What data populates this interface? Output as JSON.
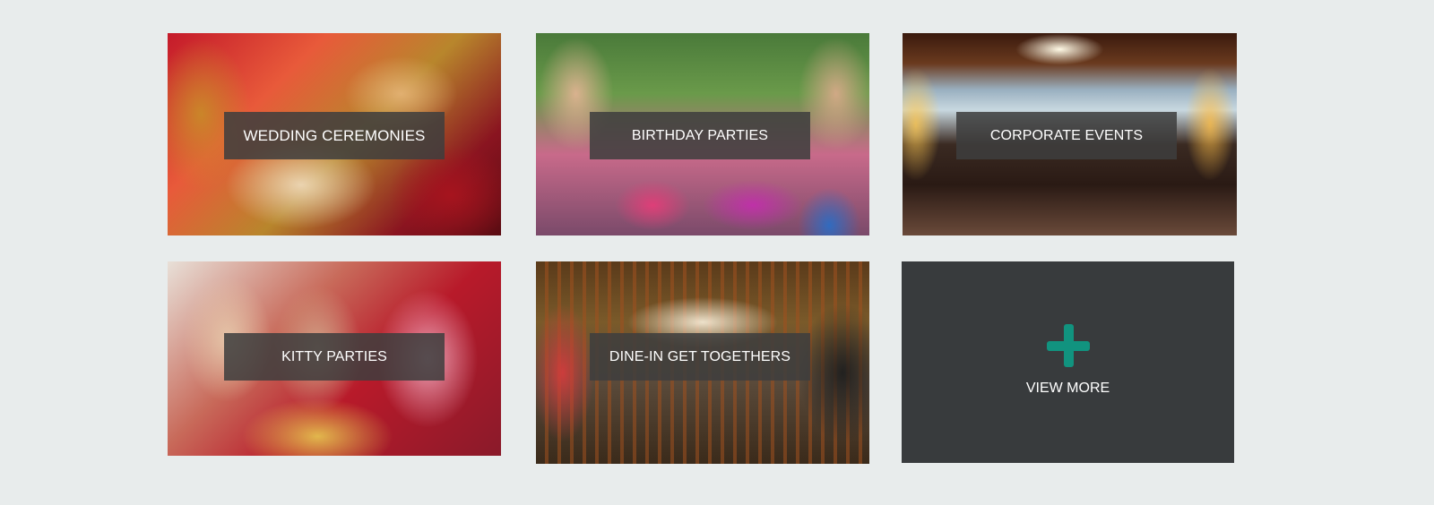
{
  "tiles": [
    {
      "label": "WEDDING CEREMONIES"
    },
    {
      "label": "BIRTHDAY PARTIES"
    },
    {
      "label": "CORPORATE EVENTS"
    },
    {
      "label": "KITTY PARTIES"
    },
    {
      "label": "DINE-IN GET TOGETHERS"
    }
  ],
  "view_more": {
    "label": "VIEW MORE",
    "icon": "plus-icon",
    "icon_color": "#11937f"
  },
  "colors": {
    "background": "#e8ecec",
    "caption_bg": "#3e3e3e",
    "view_more_bg": "#383b3d"
  }
}
